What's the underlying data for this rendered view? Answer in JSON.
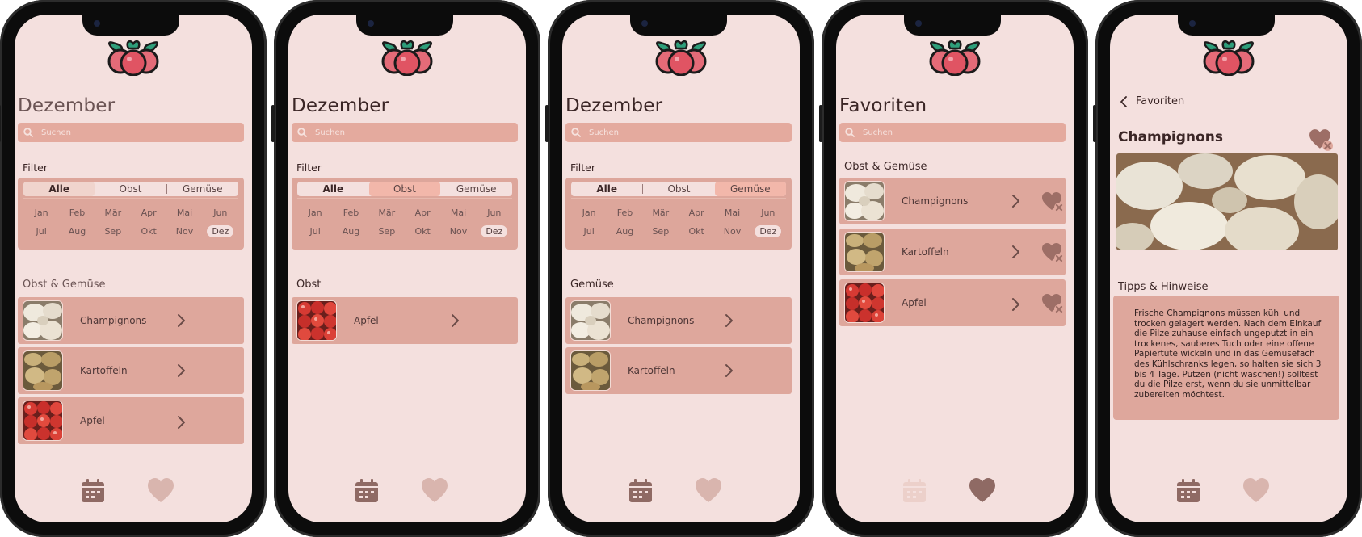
{
  "colors": {
    "screen_bg": "#f4e0de",
    "card_bg": "#dea79c",
    "search_bg": "#e4aa9e",
    "segment_selected": "#f2b7aa",
    "icon_brown": "#8f6a64",
    "icon_faded": "#d9b5ae"
  },
  "search": {
    "placeholder": "Suchen"
  },
  "filter": {
    "label": "Filter",
    "segments": [
      "Alle",
      "Obst",
      "Gemüse"
    ],
    "months_row1": [
      "Jan",
      "Feb",
      "Mär",
      "Apr",
      "Mai",
      "Jun"
    ],
    "months_row2": [
      "Jul",
      "Aug",
      "Sep",
      "Okt",
      "Nov",
      "Dez"
    ],
    "active_month": "Dez"
  },
  "screens": [
    {
      "title": "Dezember",
      "selected_filter": "Alle",
      "section": "Obst & Gemüse",
      "items": [
        {
          "name": "Champignons",
          "image": "mushrooms"
        },
        {
          "name": "Kartoffeln",
          "image": "potatoes"
        },
        {
          "name": "Apfel",
          "image": "apples"
        }
      ],
      "nav_active": "calendar"
    },
    {
      "title": "Dezember",
      "selected_filter": "Obst",
      "section": "Obst",
      "items": [
        {
          "name": "Apfel",
          "image": "apples"
        }
      ],
      "nav_active": "calendar"
    },
    {
      "title": "Dezember",
      "selected_filter": "Gemüse",
      "section": "Gemüse",
      "items": [
        {
          "name": "Champignons",
          "image": "mushrooms"
        },
        {
          "name": "Kartoffeln",
          "image": "potatoes"
        }
      ],
      "nav_active": "calendar"
    },
    {
      "title": "Favoriten",
      "section": "Obst & Gemüse",
      "items": [
        {
          "name": "Champignons",
          "image": "mushrooms"
        },
        {
          "name": "Kartoffeln",
          "image": "potatoes"
        },
        {
          "name": "Apfel",
          "image": "apples"
        }
      ],
      "nav_active": "heart"
    },
    {
      "back_label": "Favoriten",
      "detail_title": "Champignons",
      "tips_title": "Tipps & Hinweise",
      "tips_text": "Frische Champignons müssen kühl und trocken gelagert werden. Nach dem Einkauf die Pilze zuhause einfach ungeputzt in ein trockenes, sauberes Tuch oder eine offene Papiertüte wickeln und in das Gemüsefach des Kühlschranks legen, so halten sie sich 3 bis 4 Tage. Putzen (nicht waschen!) solltest du die Pilze erst, wenn du sie unmittelbar zubereiten möchtest.",
      "nav_active": "calendar"
    }
  ]
}
